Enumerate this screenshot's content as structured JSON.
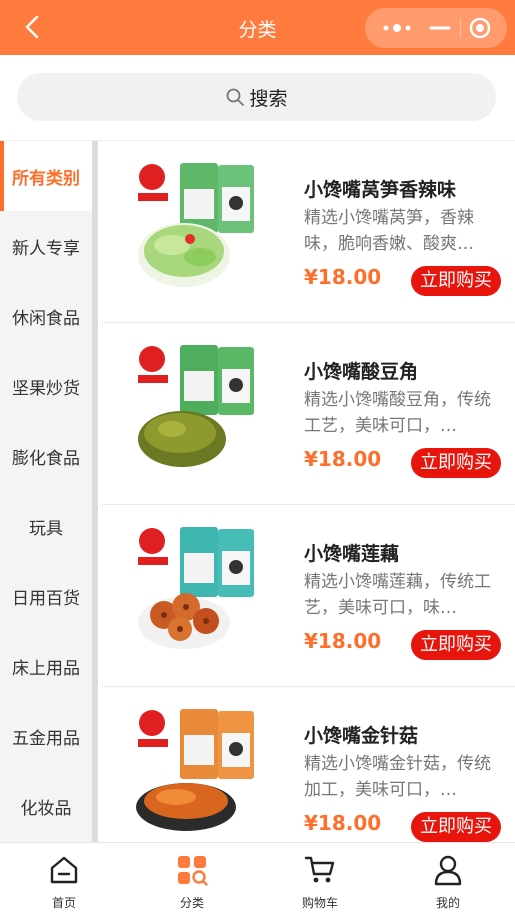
{
  "header": {
    "title": "分类"
  },
  "search": {
    "label": "搜索"
  },
  "categories": [
    {
      "label": "所有类别",
      "active": true
    },
    {
      "label": "新人专享"
    },
    {
      "label": "休闲食品"
    },
    {
      "label": "坚果炒货"
    },
    {
      "label": "膨化食品"
    },
    {
      "label": "玩具"
    },
    {
      "label": "日用百货"
    },
    {
      "label": "床上用品"
    },
    {
      "label": "五金用品"
    },
    {
      "label": "化妆品"
    }
  ],
  "products": [
    {
      "name": "小馋嘴莴笋香辣味",
      "desc": "精选小馋嘴莴笋，香辣味，脆响香嫩、酸爽…",
      "price": "¥18.00",
      "buy": "立即购买"
    },
    {
      "name": "小馋嘴酸豆角",
      "desc": "精选小馋嘴酸豆角，传统工艺，美味可口，…",
      "price": "¥18.00",
      "buy": "立即购买"
    },
    {
      "name": "小馋嘴莲藕",
      "desc": "精选小馋嘴莲藕，传统工艺，美味可口，味…",
      "price": "¥18.00",
      "buy": "立即购买"
    },
    {
      "name": "小馋嘴金针菇",
      "desc": "精选小馋嘴金针菇，传统加工，美味可口，…",
      "price": "¥18.00",
      "buy": "立即购买"
    }
  ],
  "tabbar": [
    {
      "label": "首页",
      "icon": "home-icon"
    },
    {
      "label": "分类",
      "icon": "category-icon",
      "active": true
    },
    {
      "label": "购物车",
      "icon": "cart-icon"
    },
    {
      "label": "我的",
      "icon": "profile-icon"
    }
  ],
  "colors": {
    "accent": "#ff7a3d",
    "price": "#ff6f2c",
    "buy": "#e8150d"
  }
}
